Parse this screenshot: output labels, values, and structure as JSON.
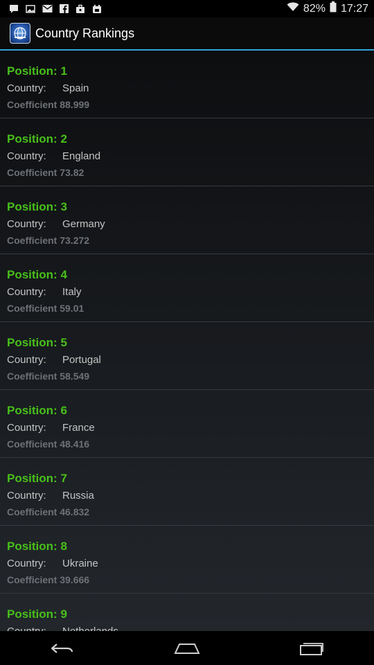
{
  "status_bar": {
    "notification_icons": [
      "chat-icon",
      "image-icon",
      "mail-icon",
      "facebook-icon",
      "briefcase-icon",
      "calendar-icon"
    ],
    "battery_percent": "82%",
    "time": "17:27"
  },
  "action_bar": {
    "title": "Country Rankings",
    "app_icon": "globe-icon"
  },
  "rankings": [
    {
      "position": "Position: 1",
      "country_label": "Country:",
      "country": "Spain",
      "coefficient": "Coefficient 88.999"
    },
    {
      "position": "Position: 2",
      "country_label": "Country:",
      "country": "England",
      "coefficient": "Coefficient 73.82"
    },
    {
      "position": "Position: 3",
      "country_label": "Country:",
      "country": "Germany",
      "coefficient": "Coefficient 73.272"
    },
    {
      "position": "Position: 4",
      "country_label": "Country:",
      "country": "Italy",
      "coefficient": "Coefficient 59.01"
    },
    {
      "position": "Position: 5",
      "country_label": "Country:",
      "country": "Portugal",
      "coefficient": "Coefficient 58.549"
    },
    {
      "position": "Position: 6",
      "country_label": "Country:",
      "country": "France",
      "coefficient": "Coefficient 48.416"
    },
    {
      "position": "Position: 7",
      "country_label": "Country:",
      "country": "Russia",
      "coefficient": "Coefficient 46.832"
    },
    {
      "position": "Position: 8",
      "country_label": "Country:",
      "country": "Ukraine",
      "coefficient": "Coefficient 39.666"
    },
    {
      "position": "Position: 9",
      "country_label": "Country:",
      "country": "Netherlands",
      "coefficient": ""
    }
  ],
  "nav_bar": {
    "buttons": [
      "back-icon",
      "home-icon",
      "recents-icon"
    ]
  },
  "colors": {
    "position_text": "#48c01a",
    "accent_divider": "#33a5d6",
    "coefficient_text": "#6e7277"
  }
}
